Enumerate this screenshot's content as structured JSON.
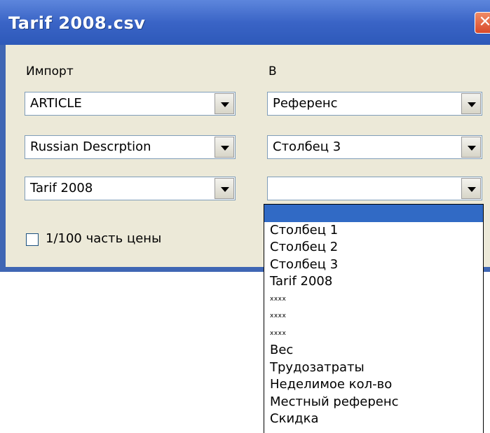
{
  "window": {
    "title": "Tarif 2008.csv",
    "close_glyph": "✕"
  },
  "labels": {
    "import": "Импорт",
    "to": "В"
  },
  "left_combos": [
    {
      "value": "ARTICLE"
    },
    {
      "value": "Russian Descrption"
    },
    {
      "value": "Tarif 2008"
    }
  ],
  "right_combos": [
    {
      "value": "Референс"
    },
    {
      "value": "Столбец 3"
    },
    {
      "value": ""
    }
  ],
  "checkbox": {
    "label": "1/100 часть цены",
    "checked": false
  },
  "dropdown": {
    "options": [
      "",
      "Столбец 1",
      "Столбец 2",
      "Столбец 3",
      "Tarif 2008",
      "xxxx",
      "xxxx",
      "xxxx",
      "Вес",
      "Трудозатраты",
      "Неделимое кол-во",
      "Местный референс",
      "Скидка"
    ],
    "highlighted_index": 0
  },
  "colors": {
    "title_bar": "#3a64c6",
    "client_bg": "#ece9d8",
    "selection": "#316ac5",
    "close_button": "#d8492a"
  }
}
